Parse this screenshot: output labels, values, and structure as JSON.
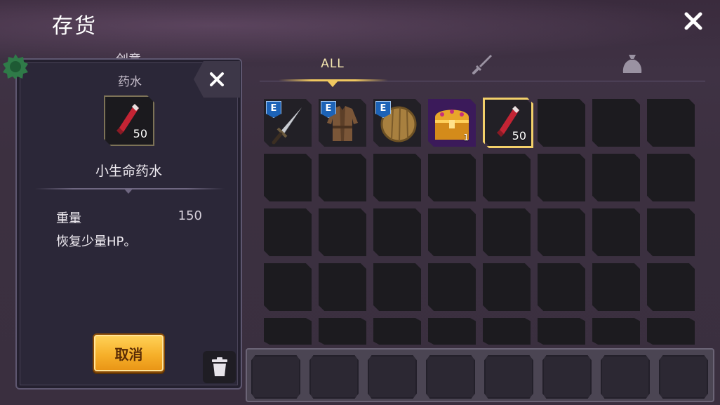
{
  "screen": {
    "title": "存货",
    "peek_label": "创意"
  },
  "tabs": [
    {
      "label": "ALL",
      "active": true,
      "icon": ""
    },
    {
      "label": "",
      "active": false,
      "icon": "sword-icon"
    },
    {
      "label": "",
      "active": false,
      "icon": "bag-icon"
    }
  ],
  "detail": {
    "category": "药水",
    "item_name": "小生命药水",
    "quantity": "50",
    "stat_label": "重量",
    "stat_value": "150",
    "description": "恢复少量HP。",
    "cancel_label": "取消"
  },
  "inventory": {
    "items": [
      {
        "name": "dagger",
        "badge": "E",
        "icon": "dagger-icon"
      },
      {
        "name": "leather-armor",
        "badge": "E",
        "icon": "armor-icon"
      },
      {
        "name": "wooden-shield",
        "badge": "E",
        "icon": "shield-icon"
      },
      {
        "name": "treasure-chest",
        "badge": "",
        "icon": "chest-icon",
        "qty": "1"
      },
      {
        "name": "health-potion",
        "badge": "",
        "icon": "potion-icon",
        "qty": "50",
        "selected": true
      }
    ]
  },
  "colors": {
    "accent_gold": "#f3d06a",
    "badge_blue": "#1d63b7",
    "button_orange": "#f6b02a",
    "panel_bg": "#2b2738"
  }
}
